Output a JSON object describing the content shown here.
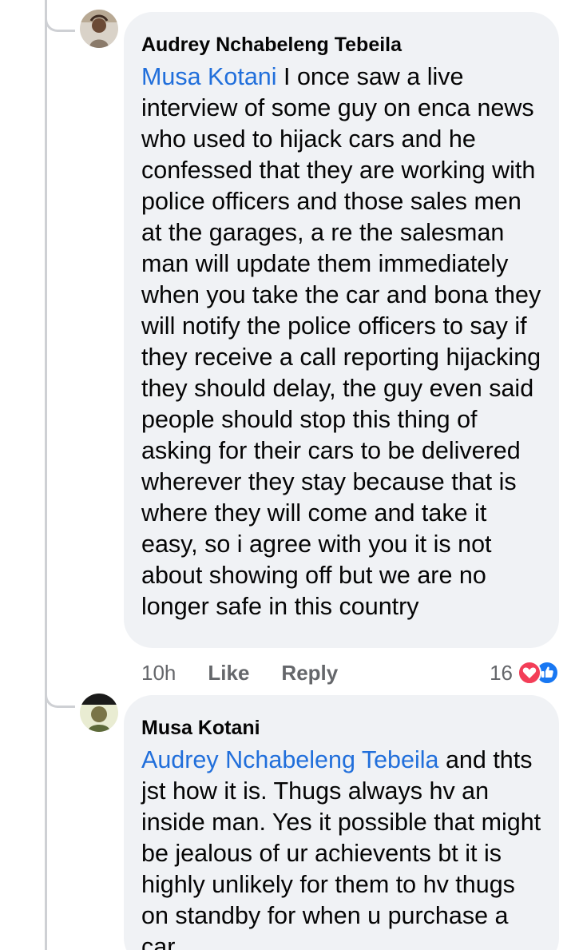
{
  "comment1": {
    "author": "Audrey Nchabeleng Tebeila",
    "mention": "Musa Kotani",
    "text": " I once saw a live interview of some guy on enca news who used to hijack cars and he confessed that they are working with police officers and those sales men at the garages, a re the salesman man will update them immediately when you take the car and bona they will notify the police officers to say if they receive a call reporting hijacking they should delay, the guy even said people should stop this thing of asking for their cars to be delivered wherever they stay because that is where they will come and take it easy, so i agree with you it is not about showing off but we are no longer safe in this country",
    "time": "10h",
    "like_label": "Like",
    "reply_label": "Reply",
    "reaction_count": "16",
    "reaction_icons": [
      "love-icon",
      "like-icon"
    ],
    "colors": {
      "love": "#f33e58",
      "like": "#1877f2"
    }
  },
  "comment2": {
    "author": "Musa Kotani",
    "mention": "Audrey Nchabeleng Tebeila",
    "text": " and thts jst how it is. Thugs always hv an inside man. Yes it possible that might be jealous of ur achievents bt it is highly unlikely for them to hv thugs on standby for when u purchase a car"
  },
  "theme": {
    "bubble_bg": "#f0f2f5",
    "mention_color": "#216fdb",
    "meta_color": "#65676b"
  }
}
